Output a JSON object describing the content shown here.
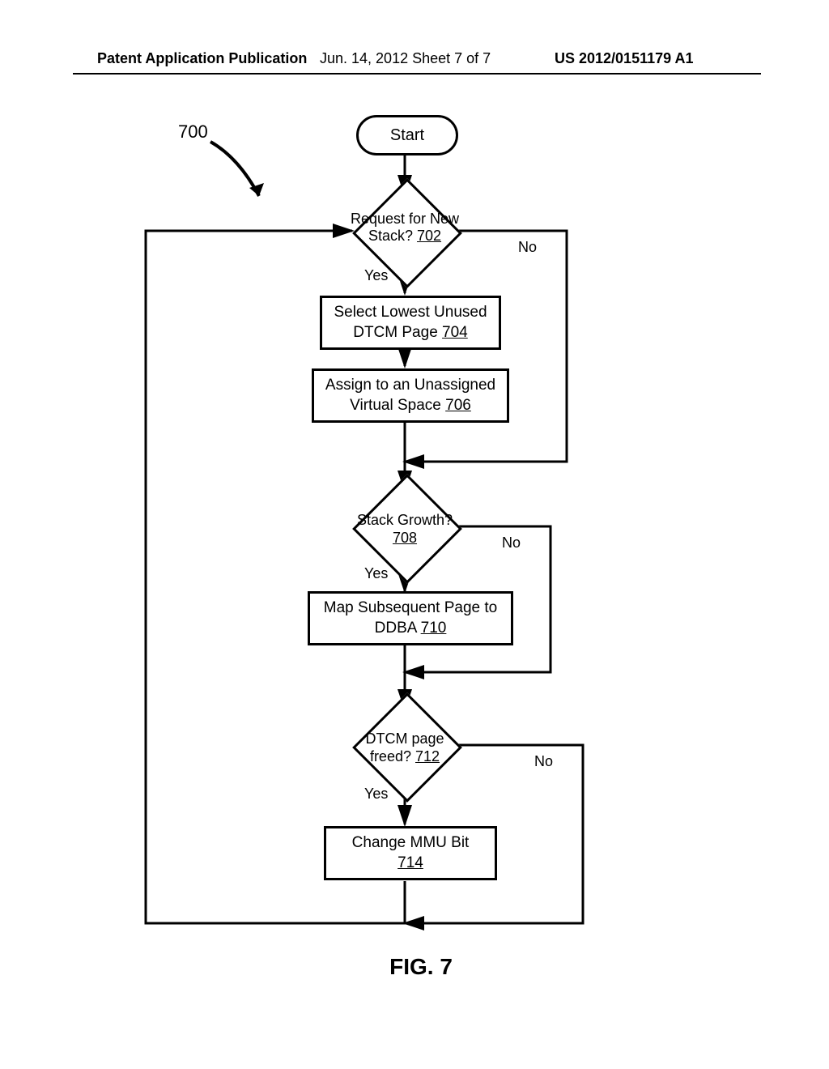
{
  "header": {
    "left": "Patent Application Publication",
    "center": "Jun. 14, 2012  Sheet 7 of 7",
    "right": "US 2012/0151179 A1"
  },
  "ref": "700",
  "start": "Start",
  "d702": {
    "text": "Request for New Stack?",
    "ref": "702",
    "yes": "Yes",
    "no": "No"
  },
  "p704": {
    "text": "Select Lowest Unused DTCM Page",
    "ref": "704"
  },
  "p706": {
    "text": "Assign to an Unassigned Virtual Space",
    "ref": "706"
  },
  "d708": {
    "text": "Stack Growth?",
    "ref": "708",
    "yes": "Yes",
    "no": "No"
  },
  "p710": {
    "text": "Map Subsequent Page to DDBA",
    "ref": "710"
  },
  "d712": {
    "text": "DTCM page freed?",
    "ref": "712",
    "yes": "Yes",
    "no": "No"
  },
  "p714": {
    "text": "Change MMU Bit",
    "ref": "714"
  },
  "figure": "FIG. 7",
  "chart_data": {
    "type": "flowchart",
    "title": "FIG. 7",
    "reference": "700",
    "nodes": [
      {
        "id": "start",
        "type": "terminator",
        "label": "Start"
      },
      {
        "id": "702",
        "type": "decision",
        "label": "Request for New Stack?",
        "ref": "702"
      },
      {
        "id": "704",
        "type": "process",
        "label": "Select Lowest Unused DTCM Page",
        "ref": "704"
      },
      {
        "id": "706",
        "type": "process",
        "label": "Assign to an Unassigned Virtual Space",
        "ref": "706"
      },
      {
        "id": "708",
        "type": "decision",
        "label": "Stack Growth?",
        "ref": "708"
      },
      {
        "id": "710",
        "type": "process",
        "label": "Map Subsequent Page to DDBA",
        "ref": "710"
      },
      {
        "id": "712",
        "type": "decision",
        "label": "DTCM page freed?",
        "ref": "712"
      },
      {
        "id": "714",
        "type": "process",
        "label": "Change MMU Bit",
        "ref": "714"
      }
    ],
    "edges": [
      {
        "from": "start",
        "to": "702"
      },
      {
        "from": "702",
        "to": "704",
        "label": "Yes"
      },
      {
        "from": "702",
        "to": "708",
        "label": "No"
      },
      {
        "from": "704",
        "to": "706"
      },
      {
        "from": "706",
        "to": "708"
      },
      {
        "from": "708",
        "to": "710",
        "label": "Yes"
      },
      {
        "from": "708",
        "to": "712",
        "label": "No"
      },
      {
        "from": "710",
        "to": "712"
      },
      {
        "from": "712",
        "to": "714",
        "label": "Yes"
      },
      {
        "from": "712",
        "to": "702",
        "label": "No"
      },
      {
        "from": "714",
        "to": "702"
      }
    ]
  }
}
